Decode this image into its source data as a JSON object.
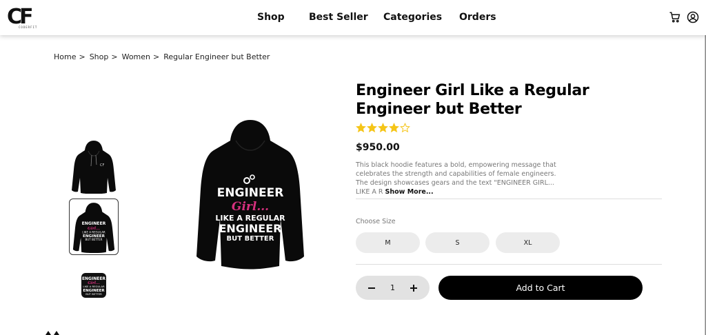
{
  "header": {
    "logo_text": "CF",
    "logo_sub": "CODERFIT",
    "nav": [
      "Shop",
      "Best Seller",
      "Categories",
      "Orders"
    ],
    "icons": [
      "cart-icon",
      "account-icon"
    ]
  },
  "breadcrumb": [
    "Home",
    "Shop",
    "Women",
    "Regular Engineer but Better"
  ],
  "breadcrumb_sep": ">",
  "product": {
    "title": "Engineer Girl Like a Regular Engineer but Better",
    "rating": 4,
    "rating_max": 5,
    "price": "$950.00",
    "description": "This black hoodie features a bold, empowering message that celebrates the strength and capabilities of female engineers. The design showcases gears and the text \"ENGINEER GIRL... LIKE A R",
    "show_more": "Show More...",
    "size_label": "Choose Size",
    "sizes": [
      "M",
      "S",
      "XL"
    ],
    "quantity": "1",
    "add_to_cart": "Add to Cart"
  },
  "design_text": {
    "line1": "ENGINEER",
    "line2": "Girl...",
    "line3": "LIKE A REGULAR",
    "line4": "ENGINEER",
    "line5": "BUT BETTER"
  },
  "colors": {
    "star": "#f5c518",
    "accent_pink": "#d6307e",
    "button_dark": "#000000",
    "size_bg": "#ececec"
  }
}
